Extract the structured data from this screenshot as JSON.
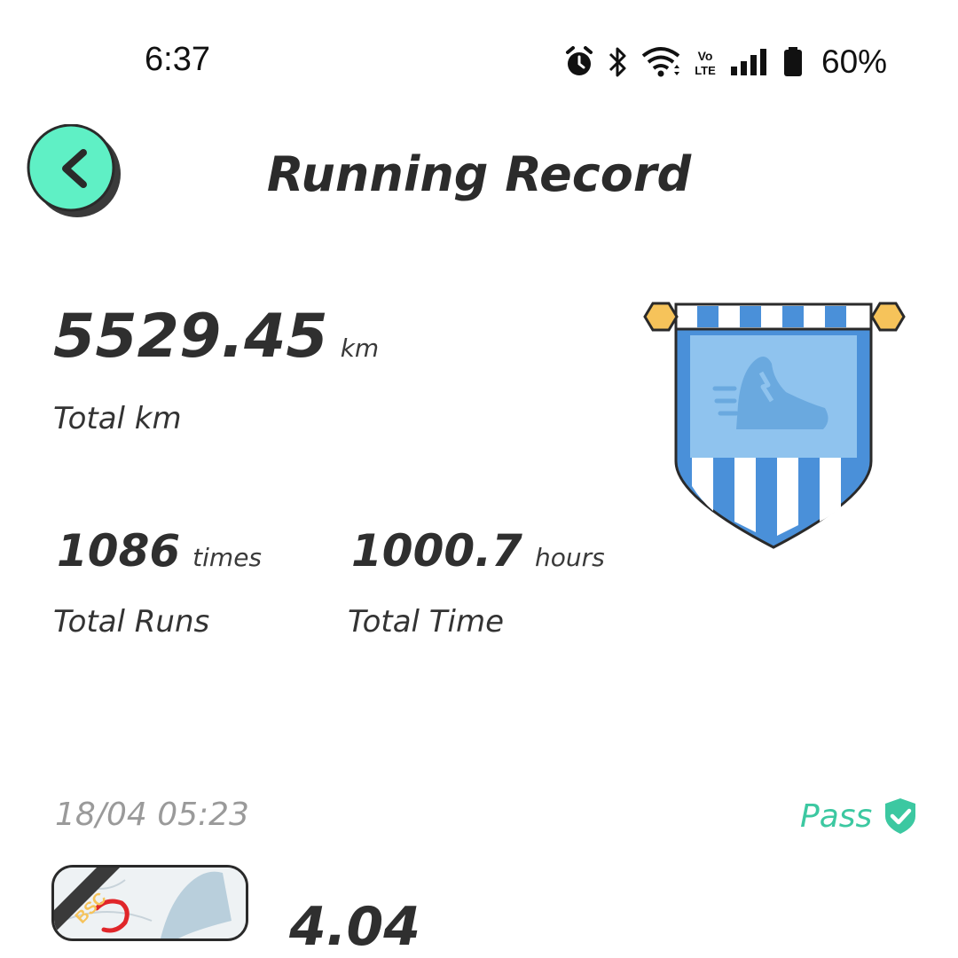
{
  "status_bar": {
    "time": "6:37",
    "battery": "60%",
    "icons": [
      "alarm-icon",
      "bluetooth-icon",
      "wifi-icon",
      "volte-icon",
      "signal-icon",
      "battery-icon"
    ]
  },
  "header": {
    "title": "Running Record",
    "back_icon": "chevron-left-icon",
    "back_color": "#5ff0c5"
  },
  "summary": {
    "total_km_value": "5529.45",
    "total_km_unit": "km",
    "total_km_label": "Total km",
    "runs_value": "1086",
    "runs_unit": "times",
    "runs_label": "Total Runs",
    "time_value": "1000.7",
    "time_unit": "hours",
    "time_label": "Total Time",
    "badge_icon": "running-shoe-pennant-icon",
    "badge_colors": {
      "primary": "#4a90d9",
      "light": "#8fc3ee",
      "gold": "#f6c35a"
    }
  },
  "records": [
    {
      "date": "18/04 05:23",
      "status": "Pass",
      "status_color": "#3cc8a1",
      "map_tag": "BSC",
      "distance_partial": "4.04"
    }
  ]
}
